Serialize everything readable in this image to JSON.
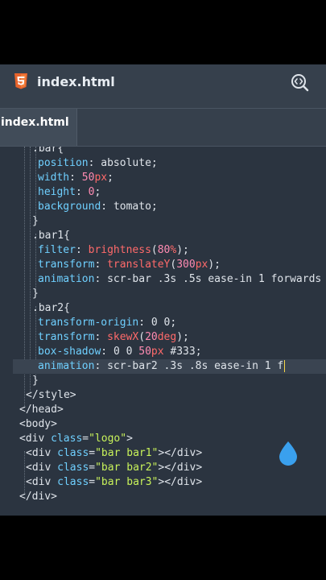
{
  "header": {
    "title": "index.html",
    "file_icon": "html5-icon",
    "action_icon": "preview-icon"
  },
  "tabs": [
    {
      "label": "index.html",
      "active": true
    }
  ],
  "code": {
    "l1": {
      "sel": ".bar{"
    },
    "l2": {
      "prop": "position",
      "p": ": ",
      "val": "absolute;"
    },
    "l3": {
      "prop": "width",
      "p": ": ",
      "num": "50",
      "unit": "px",
      "end": ";"
    },
    "l4": {
      "prop": "height",
      "p": ": ",
      "num": "0",
      "end": ";"
    },
    "l5": {
      "prop": "background",
      "p": ": ",
      "val": "tomato;"
    },
    "l6": {
      "text": "}"
    },
    "l7": {
      "sel": ".bar1{"
    },
    "l8": {
      "prop": "filter",
      "p": ": ",
      "fn": "brightness",
      "o": "(",
      "num": "80",
      "unit": "%",
      "c": ");"
    },
    "l9": {
      "prop": "transform",
      "p": ": ",
      "fn": "translateY",
      "o": "(",
      "num": "300",
      "unit": "px",
      "c": ");"
    },
    "l10": {
      "prop": "animation",
      "p": ": ",
      "val": "scr-bar .3s .5s ease-in 1 forwards"
    },
    "l11": {
      "text": "}"
    },
    "l12": {
      "sel": ".bar2{"
    },
    "l13": {
      "prop": "transform-origin",
      "p": ": ",
      "val": "0 0;"
    },
    "l14": {
      "prop": "transform",
      "p": ": ",
      "fn": "skewX",
      "o": "(",
      "num": "20",
      "unit": "deg",
      "c": ");"
    },
    "l15": {
      "prop": "box-shadow",
      "p": ": ",
      "val": "0 0 ",
      "num": "50",
      "unit": "px",
      "end": " #333;"
    },
    "l16": {
      "prop": "animation",
      "p": ": ",
      "val": "scr-bar2 .3s .8s ease-in 1 f"
    },
    "l17": {
      "text": "}"
    },
    "l18": {
      "text": "</style>"
    },
    "l19": {
      "text": "</head>"
    },
    "l20": {
      "text": "<body>"
    },
    "l21": {
      "o": "<div ",
      "attr": "class",
      "eq": "=",
      "str": "\"logo\"",
      "c": ">"
    },
    "l22": {
      "o": "<div ",
      "attr": "class",
      "eq": "=",
      "str": "\"bar bar1\"",
      "c": "></div>"
    },
    "l23": {
      "o": "<div ",
      "attr": "class",
      "eq": "=",
      "str": "\"bar bar2\"",
      "c": "></div>"
    },
    "l24": {
      "o": "<div ",
      "attr": "class",
      "eq": "=",
      "str": "\"bar bar3\"",
      "c": "></div>"
    },
    "l25": {
      "text": "</div>"
    }
  },
  "colors": {
    "property": "#6fd0ff",
    "number": "#ff8bb2",
    "unit": "#ff6a6a",
    "string": "#c8f25a",
    "cursor": "#f7d64a",
    "handle": "#3aa0ee"
  }
}
